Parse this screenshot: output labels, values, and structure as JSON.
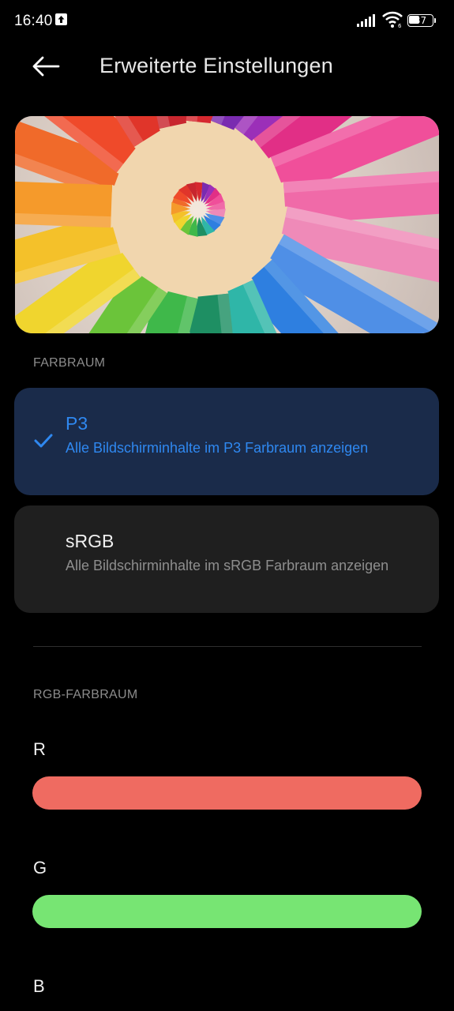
{
  "status_bar": {
    "time": "16:40",
    "battery_level": "37"
  },
  "header": {
    "title": "Erweiterte Einstellungen"
  },
  "color_space": {
    "section_label": "FARBRAUM",
    "options": [
      {
        "title": "P3",
        "description": "Alle Bildschirminhalte im P3 Farbraum anzeigen",
        "selected": true
      },
      {
        "title": "sRGB",
        "description": "Alle Bildschirminhalte im sRGB Farbraum anzeigen",
        "selected": false
      }
    ]
  },
  "rgb_color_space": {
    "section_label": "RGB-FARBRAUM",
    "channels": [
      {
        "label": "R",
        "color": "#ef6b61"
      },
      {
        "label": "G",
        "color": "#77e573"
      },
      {
        "label": "B",
        "color": "#5a8fe8"
      }
    ]
  },
  "colors": {
    "accent": "#2f88f0",
    "selected_card_bg": "#1a2b4a",
    "card_bg": "#1f1f1f",
    "background": "#000000"
  }
}
